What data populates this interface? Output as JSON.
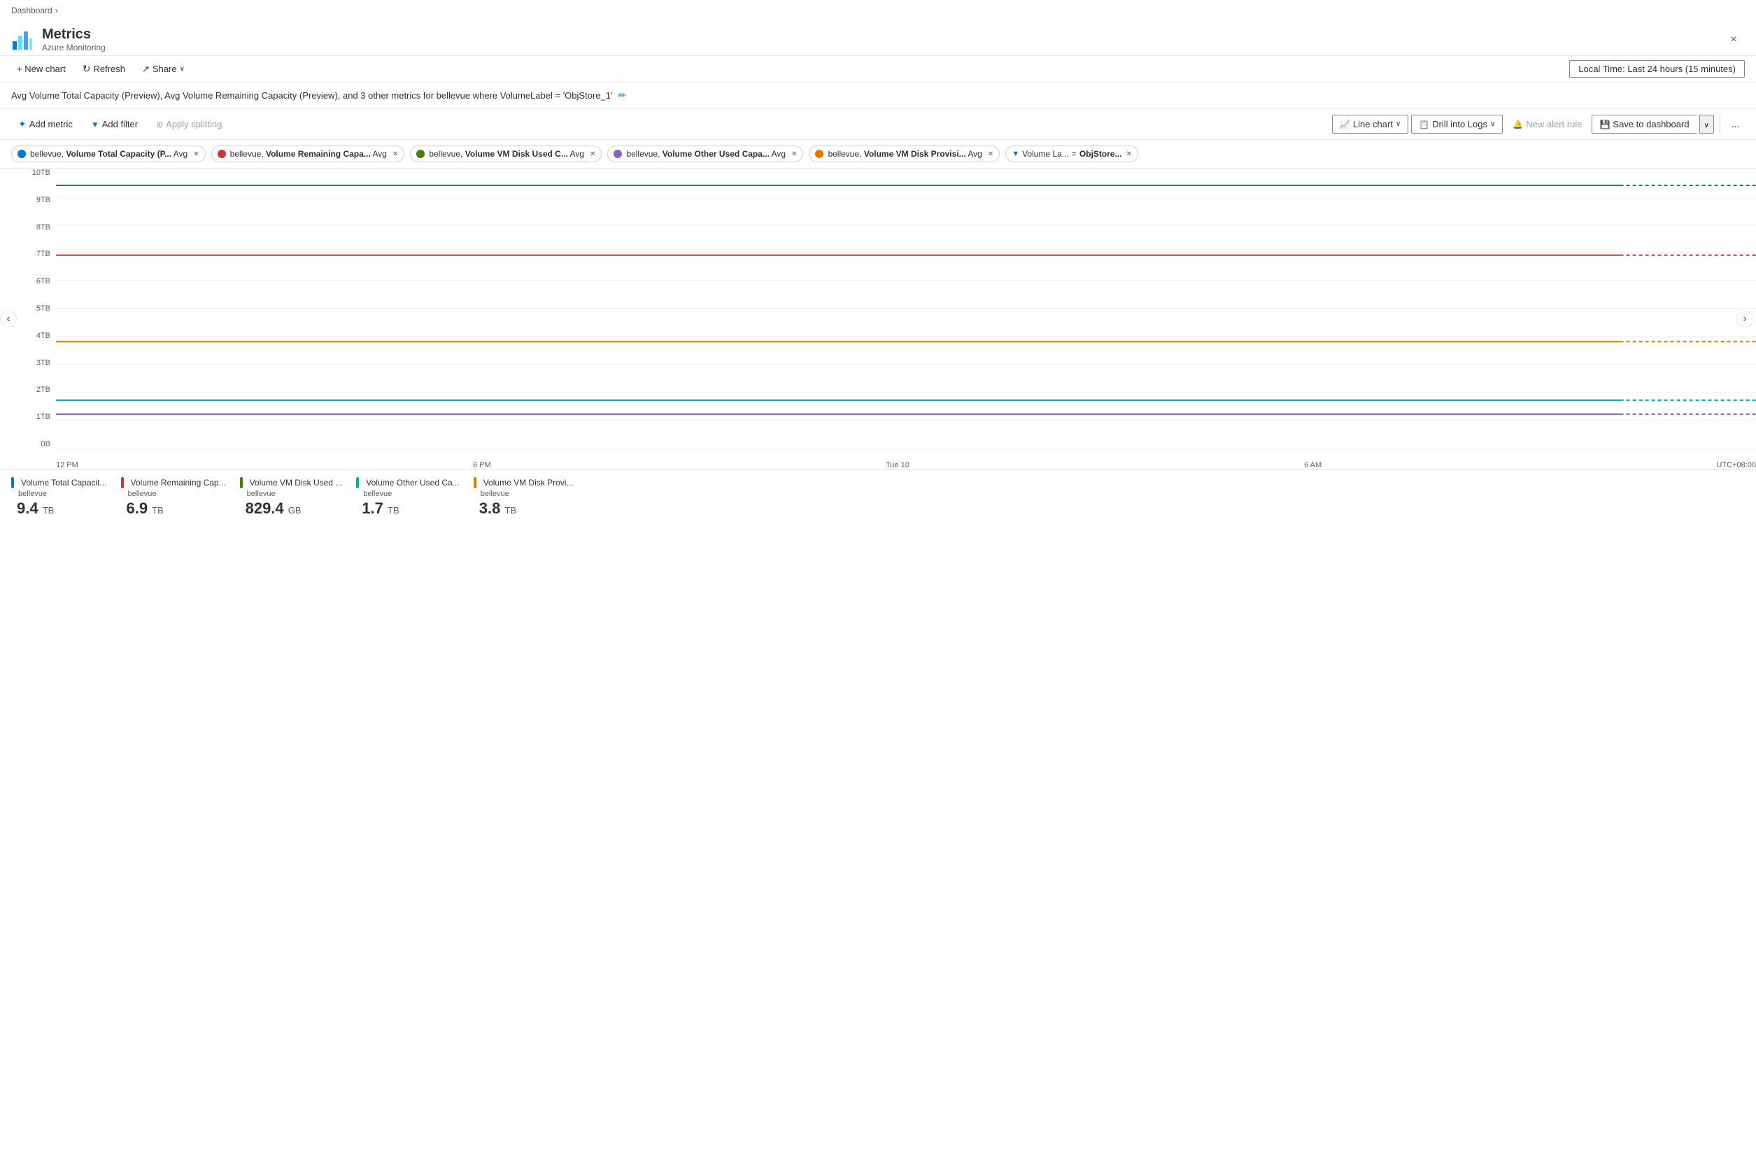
{
  "breadcrumb": {
    "label": "Dashboard",
    "arrow": "›"
  },
  "header": {
    "title": "Metrics",
    "subtitle": "Azure Monitoring",
    "close_label": "×"
  },
  "toolbar": {
    "new_chart": "+ New chart",
    "refresh": "Refresh",
    "share": "Share",
    "time_range": "Local Time: Last 24 hours (15 minutes)"
  },
  "chart_title": "Avg Volume Total Capacity (Preview), Avg Volume Remaining Capacity (Preview), and 3 other metrics for bellevue where VolumeLabel = 'ObjStore_1'",
  "controls": {
    "add_metric": "Add metric",
    "add_filter": "Add filter",
    "apply_splitting": "Apply splitting",
    "line_chart": "Line chart",
    "drill_into_logs": "Drill into Logs",
    "new_alert_rule": "New alert rule",
    "save_to_dashboard": "Save to dashboard",
    "more": "..."
  },
  "metrics": [
    {
      "label": "bellevue, ",
      "bold": "Volume Total Capacity (P...",
      "agg": "Avg",
      "color": "#0078d4"
    },
    {
      "label": "bellevue, ",
      "bold": "Volume Remaining Capa...",
      "agg": "Avg",
      "color": "#d13438"
    },
    {
      "label": "bellevue, ",
      "bold": "Volume VM Disk Used C...",
      "agg": "Avg",
      "color": "#498205"
    },
    {
      "label": "bellevue, ",
      "bold": "Volume Other Used Capa...",
      "agg": "Avg",
      "color": "#8764b8"
    },
    {
      "label": "bellevue, ",
      "bold": "Volume VM Disk Provisi...",
      "agg": "Avg",
      "color": "#e07c00"
    }
  ],
  "filter_tag": {
    "label": "Volume La...",
    "op": "=",
    "value": "ObjStore..."
  },
  "chart": {
    "y_labels": [
      "10TB",
      "9TB",
      "8TB",
      "7TB",
      "6TB",
      "5TB",
      "4TB",
      "3TB",
      "2TB",
      "1TB",
      "0B"
    ],
    "x_labels": [
      "12 PM",
      "6 PM",
      "Tue 10",
      "6 AM",
      "UTC+08:00"
    ],
    "lines": [
      {
        "color": "#0078d4",
        "top_pct": 10,
        "label": "Volume Total Capacity line"
      },
      {
        "color": "#d13438",
        "top_pct": 31,
        "label": "Volume Remaining Capacity line"
      },
      {
        "color": "#e07c00",
        "top_pct": 63,
        "label": "Volume VM Disk Provisioned line"
      },
      {
        "color": "#00b294",
        "top_pct": 79,
        "label": "Volume Other Used Capacity line"
      },
      {
        "color": "#8764b8",
        "top_pct": 87,
        "label": "Volume VM Disk Used line"
      }
    ]
  },
  "legend": [
    {
      "name": "Volume Total Capacit...",
      "server": "bellevue",
      "value": "9.4",
      "unit": "TB",
      "color": "#0078d4"
    },
    {
      "name": "Volume Remaining Cap...",
      "server": "bellevue",
      "value": "6.9",
      "unit": "TB",
      "color": "#d13438"
    },
    {
      "name": "Volume VM Disk Used ...",
      "server": "bellevue",
      "value": "829.4",
      "unit": "GB",
      "color": "#498205"
    },
    {
      "name": "Volume Other Used Ca...",
      "server": "bellevue",
      "value": "1.7",
      "unit": "TB",
      "color": "#00b294"
    },
    {
      "name": "Volume VM Disk Provi...",
      "server": "bellevue",
      "value": "3.8",
      "unit": "TB",
      "color": "#e07c00"
    }
  ]
}
